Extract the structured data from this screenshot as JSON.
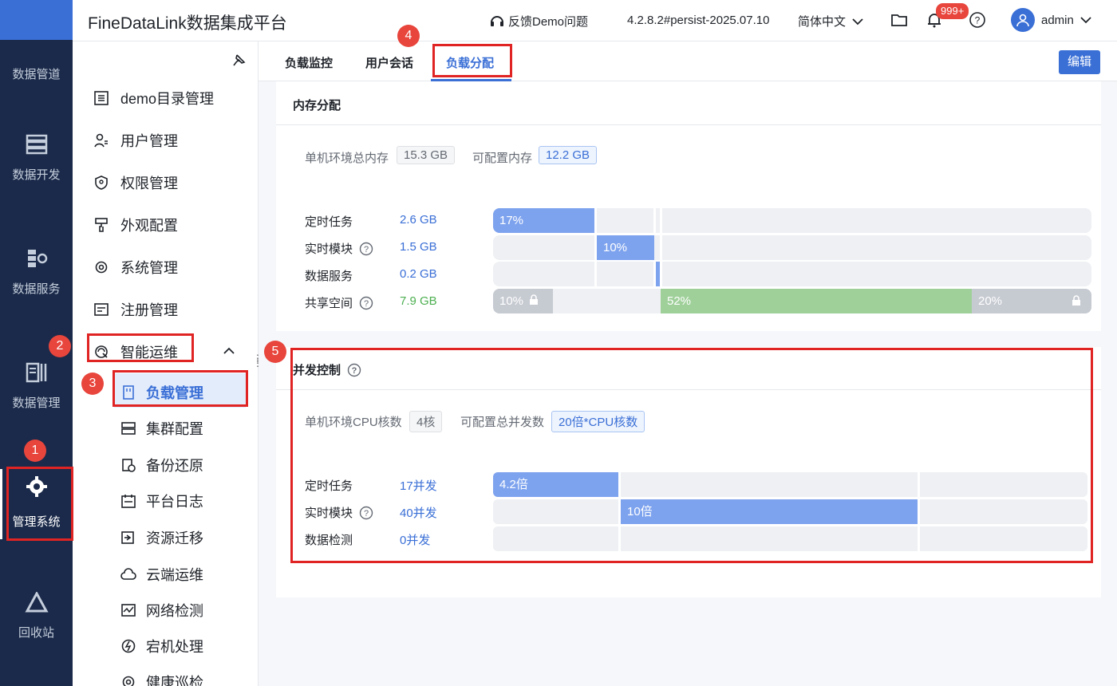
{
  "app": {
    "title": "FineDataLink数据集成平台"
  },
  "header": {
    "feedback": "反馈Demo问题",
    "version": "4.2.8.2#persist-2025.07.10",
    "language": "简体中文",
    "notification_count": "999+",
    "user": "admin"
  },
  "rail": {
    "items": [
      {
        "label": "数据管道",
        "icon": "pipeline-icon"
      },
      {
        "label": "数据开发",
        "icon": "dev-icon"
      },
      {
        "label": "数据服务",
        "icon": "service-icon"
      },
      {
        "label": "数据管理",
        "icon": "data-manage-icon"
      },
      {
        "label": "管理系统",
        "icon": "gear-icon"
      },
      {
        "label": "回收站",
        "icon": "recycle-icon"
      }
    ]
  },
  "sidebar": {
    "items": [
      {
        "label": "demo目录管理",
        "icon": "list-icon"
      },
      {
        "label": "用户管理",
        "icon": "user-icon"
      },
      {
        "label": "权限管理",
        "icon": "shield-icon"
      },
      {
        "label": "外观配置",
        "icon": "paint-icon"
      },
      {
        "label": "系统管理",
        "icon": "gear-icon"
      },
      {
        "label": "注册管理",
        "icon": "register-icon"
      },
      {
        "label": "智能运维",
        "icon": "ops-icon"
      }
    ],
    "sub_items": [
      {
        "label": "负载管理",
        "icon": "load-icon"
      },
      {
        "label": "集群配置",
        "icon": "cluster-icon"
      },
      {
        "label": "备份还原",
        "icon": "backup-icon"
      },
      {
        "label": "平台日志",
        "icon": "log-icon"
      },
      {
        "label": "资源迁移",
        "icon": "migrate-icon"
      },
      {
        "label": "云端运维",
        "icon": "cloud-icon"
      },
      {
        "label": "网络检测",
        "icon": "network-icon"
      },
      {
        "label": "宕机处理",
        "icon": "crash-icon"
      },
      {
        "label": "健康巡检",
        "icon": "health-icon"
      }
    ]
  },
  "tabs": [
    {
      "label": "负载监控"
    },
    {
      "label": "用户会话"
    },
    {
      "label": "负载分配"
    }
  ],
  "edit_button": "编辑",
  "memory": {
    "title": "内存分配",
    "total_label": "单机环境总内存",
    "total_value": "15.3 GB",
    "configurable_label": "可配置内存",
    "configurable_value": "12.2 GB",
    "rows": [
      {
        "label": "定时任务",
        "value": "2.6 GB",
        "help": false
      },
      {
        "label": "实时模块",
        "value": "1.5 GB",
        "help": true
      },
      {
        "label": "数据服务",
        "value": "0.2 GB",
        "help": false
      },
      {
        "label": "共享空间",
        "value": "7.9 GB",
        "help": true
      }
    ],
    "bars": {
      "scheduled": {
        "percent": 17,
        "text": "17%"
      },
      "realtime": {
        "percent": 10,
        "text": "10%"
      },
      "data_service": {
        "percent": 1
      },
      "shared_locked_left": {
        "percent": 10,
        "text": "10%"
      },
      "shared_main": {
        "percent": 52,
        "text": "52%"
      },
      "shared_locked_right": {
        "percent": 20,
        "text": "20%"
      }
    }
  },
  "concurrency": {
    "title": "并发控制",
    "cpu_label": "单机环境CPU核数",
    "cpu_value": "4核",
    "config_label": "可配置总并发数",
    "config_value": "20倍*CPU核数",
    "rows": [
      {
        "label": "定时任务",
        "value": "17并发",
        "help": false
      },
      {
        "label": "实时模块",
        "value": "40并发",
        "help": true
      },
      {
        "label": "数据检测",
        "value": "0并发",
        "help": false
      }
    ],
    "bars": {
      "scheduled": {
        "text": "4.2倍"
      },
      "realtime": {
        "text": "10倍"
      }
    }
  },
  "annotations": [
    "1",
    "2",
    "3",
    "4",
    "5"
  ]
}
